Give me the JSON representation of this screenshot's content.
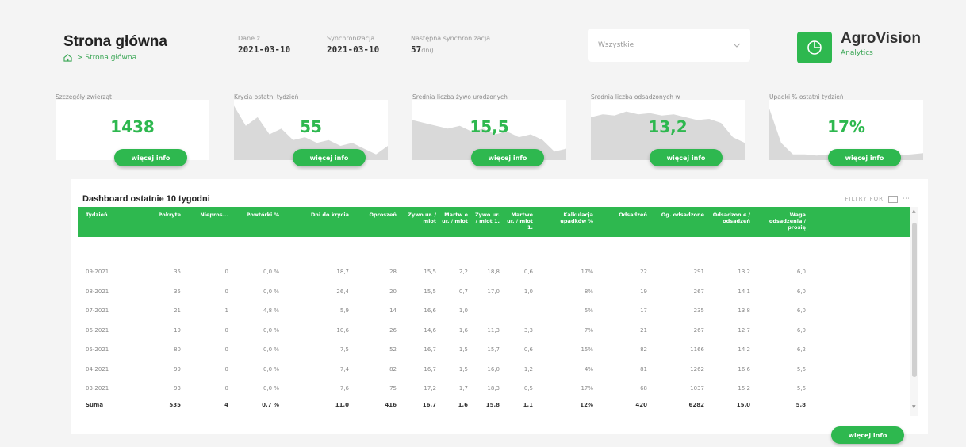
{
  "header": {
    "title": "Strona główna",
    "breadcrumb": ">  Strona główna",
    "data_label": "Dane z",
    "data_value": "2021-03-10",
    "sync_label": "Synchronizacja",
    "sync_value": "2021-03-10",
    "next_sync_label": "Następna synchronizacja",
    "next_sync_value": "57",
    "next_sync_suffix": "dni)",
    "filter_value": "Wszystkie",
    "brand_name": "AgroVision",
    "brand_sub": "Analytics"
  },
  "kpis": [
    {
      "label": "Szczegóły zwierząt",
      "value": "1438",
      "button": "więcej info"
    },
    {
      "label": "Krycia ostatni tydzień",
      "value": "55",
      "button": "więcej info"
    },
    {
      "label": "Średnia liczba żywo urodzonych",
      "value": "15,5",
      "button": "więcej info"
    },
    {
      "label": "Średnia liczba odsadzonych w",
      "value": "13,2",
      "button": "więcej info"
    },
    {
      "label": "Upadki % ostatni tydzień",
      "value": "17%",
      "button": "więcej info"
    }
  ],
  "table": {
    "title": "Dashboard ostatnie 10 tygodni",
    "tools": "FILTRY FOR",
    "headers": [
      "Tydzień",
      "Pokryte",
      "Niepros...",
      "Powtórki %",
      "Dni do krycia",
      "Oproszeń",
      "Żywo ur. / miot",
      "Martw e ur. / miot",
      "Żywo ur. / miot 1.",
      "Martwe ur. / miot 1.",
      "Kalkulacja upadków %",
      "Odsadzeń",
      "Og. odsadzone",
      "Odsadzon e / odsadzeń",
      "Waga odsadzenia / prosię"
    ],
    "rows": [
      [
        "09-2021",
        "35",
        "0",
        "0,0 %",
        "18,7",
        "28",
        "15,5",
        "2,2",
        "18,8",
        "0,6",
        "17%",
        "22",
        "291",
        "13,2",
        "6,0"
      ],
      [
        "08-2021",
        "35",
        "0",
        "0,0 %",
        "26,4",
        "20",
        "15,5",
        "0,7",
        "17,0",
        "1,0",
        "8%",
        "19",
        "267",
        "14,1",
        "6,0"
      ],
      [
        "07-2021",
        "21",
        "1",
        "4,8 %",
        "5,9",
        "14",
        "16,6",
        "1,0",
        "",
        "",
        "5%",
        "17",
        "235",
        "13,8",
        "6,0"
      ],
      [
        "06-2021",
        "19",
        "0",
        "0,0 %",
        "10,6",
        "26",
        "14,6",
        "1,6",
        "11,3",
        "3,3",
        "7%",
        "21",
        "267",
        "12,7",
        "6,0"
      ],
      [
        "05-2021",
        "80",
        "0",
        "0,0 %",
        "7,5",
        "52",
        "16,7",
        "1,5",
        "15,7",
        "0,6",
        "15%",
        "82",
        "1166",
        "14,2",
        "6,2"
      ],
      [
        "04-2021",
        "99",
        "0",
        "0,0 %",
        "7,4",
        "82",
        "16,7",
        "1,5",
        "16,0",
        "1,2",
        "4%",
        "81",
        "1262",
        "16,6",
        "5,6"
      ],
      [
        "03-2021",
        "93",
        "0",
        "0,0 %",
        "7,6",
        "75",
        "17,2",
        "1,7",
        "18,3",
        "0,5",
        "17%",
        "68",
        "1037",
        "15,2",
        "5,6"
      ]
    ],
    "total": [
      "Suma",
      "535",
      "4",
      "0,7 %",
      "11,0",
      "416",
      "16,7",
      "1,6",
      "15,8",
      "1,1",
      "12%",
      "420",
      "6282",
      "15,0",
      "5,8"
    ],
    "button": "więcej info"
  },
  "colors": {
    "accent": "#2eb84f",
    "spark": "#d9d9d9"
  },
  "sparks": [
    [],
    [
      0.95,
      0.6,
      0.75,
      0.45,
      0.55,
      0.35,
      0.4,
      0.3,
      0.35,
      0.25,
      0.3,
      0.2,
      0.1,
      0.25
    ],
    [
      0.7,
      0.65,
      0.6,
      0.55,
      0.6,
      0.5,
      0.55,
      0.45,
      0.5,
      0.4,
      0.45,
      0.35,
      0.15,
      0.2
    ],
    [
      0.75,
      0.8,
      0.78,
      0.85,
      0.8,
      0.82,
      0.78,
      0.8,
      0.75,
      0.7,
      0.72,
      0.65,
      0.4,
      0.3
    ],
    [
      0.9,
      0.3,
      0.1,
      0.1,
      0.08,
      0.1,
      0.08,
      0.07,
      0.08,
      0.1,
      0.08,
      0.09,
      0.1,
      0.12
    ]
  ]
}
